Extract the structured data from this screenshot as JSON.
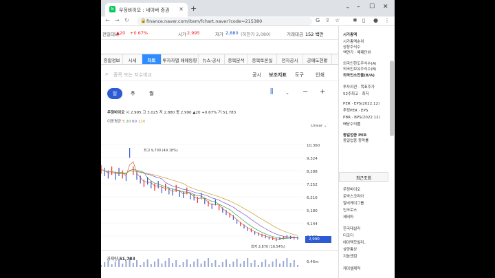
{
  "browser": {
    "tab_title": "우정바이오 : 네이버 증권",
    "url": "finance.naver.com/item/fchart.naver?code=215380"
  },
  "header": {
    "prev_label": "전일대비",
    "prev_value": "▲20",
    "prev_pct": "+0.67%",
    "open_label": "시가",
    "open_value": "2,995",
    "low_label": "저가",
    "low_value": "2,880",
    "low_limit": "(하한가 2,080)",
    "volume_amt_label": "거래대금",
    "volume_amt_value": "152 백만"
  },
  "tabs": [
    {
      "label": "종합정보"
    },
    {
      "label": "시세"
    },
    {
      "label": "차트"
    },
    {
      "label": "투자자별 매매동향"
    },
    {
      "label": "뉴스·공시"
    },
    {
      "label": "종목분석"
    },
    {
      "label": "종목토론실"
    },
    {
      "label": "전자공시"
    },
    {
      "label": "공매도현황"
    }
  ],
  "search": {
    "placeholder": "종목 또는 지수비교",
    "opt1": "공시",
    "opt2": "보조지표",
    "opt3": "도구",
    "opt4": "인쇄"
  },
  "periods": [
    {
      "label": "일"
    },
    {
      "label": "주"
    },
    {
      "label": "월"
    }
  ],
  "stock": {
    "name": "우정바이오",
    "line": "시 2,995  고 3,025  저 2,880  종 2,990 ▲20 +0.67%  거 51,783",
    "ma_label": "이동평균",
    "ma_5": "5",
    "ma_20": "20",
    "ma_60": "60",
    "ma_120": "120",
    "scale": "Linear"
  },
  "chart_data": {
    "type": "line",
    "title": "",
    "y_ticks": [
      "10,360",
      "9,324",
      "8,288",
      "7,252",
      "6,216",
      "5,180",
      "4,144",
      "3,108",
      "6.46m"
    ],
    "annotations": [
      "최고 9,700 (49.18%)",
      "최저 2,870 (16.54%)"
    ],
    "current_price": "2,990",
    "price_series": [
      8400,
      8200,
      8000,
      8300,
      7900,
      8200,
      8000,
      7800,
      9700,
      8300,
      7900,
      7600,
      7300,
      7500,
      7200,
      7000,
      7200,
      6800,
      7000,
      6700,
      6600,
      6900,
      6500,
      6400,
      6700,
      6300,
      6200,
      6000,
      6300,
      5900,
      5700,
      5500,
      5800,
      5400,
      5200,
      5000,
      4800,
      4600,
      4300,
      4100,
      3900,
      3700,
      3600,
      3400,
      3300,
      3200,
      3100,
      3000,
      2950,
      2870,
      2950,
      3000,
      3100,
      3050,
      3000,
      2990
    ],
    "ma_series": [
      {
        "name": "5",
        "color": "#e0563a"
      },
      {
        "name": "20",
        "color": "#2d9b4a"
      },
      {
        "name": "60",
        "color": "#7a4dc7"
      },
      {
        "name": "120",
        "color": "#c79b2d"
      }
    ]
  },
  "volume": {
    "label": "거래량",
    "value": "51,783"
  },
  "sidebar": {
    "items": [
      {
        "label": "시가총액"
      },
      {
        "label": "시가총액순위"
      },
      {
        "label": "상장주식수"
      },
      {
        "label": "액면가 · 매매단위"
      },
      {
        "label": "외국인한도주식수(A)"
      },
      {
        "label": "외국인보유주식수(B)"
      },
      {
        "label": "외국인소진율(B/A)"
      },
      {
        "label": "투자의견 · 목표주가"
      },
      {
        "label": "52주최고 · 최저"
      },
      {
        "label": "PER · EPS(2022.12)"
      },
      {
        "label": "추정PER · EPS"
      },
      {
        "label": "PBR · BPS(2022.12)"
      },
      {
        "label": "배당수익률"
      },
      {
        "label": "동일업종 PER"
      },
      {
        "label": "동일업종 등락률"
      }
    ],
    "recent_title": "최근조회",
    "recent": [
      {
        "label": "우정바이오"
      },
      {
        "label": "토박스코리아"
      },
      {
        "label": "알비케이그룹"
      },
      {
        "label": "인크로스"
      },
      {
        "label": "제테마"
      },
      {
        "label": "한국테실러"
      },
      {
        "label": "더코디"
      },
      {
        "label": "에이텍모빌리.."
      },
      {
        "label": "삼양통상"
      },
      {
        "label": "지놈앤컴"
      },
      {
        "label": "케이엘제약"
      }
    ]
  }
}
